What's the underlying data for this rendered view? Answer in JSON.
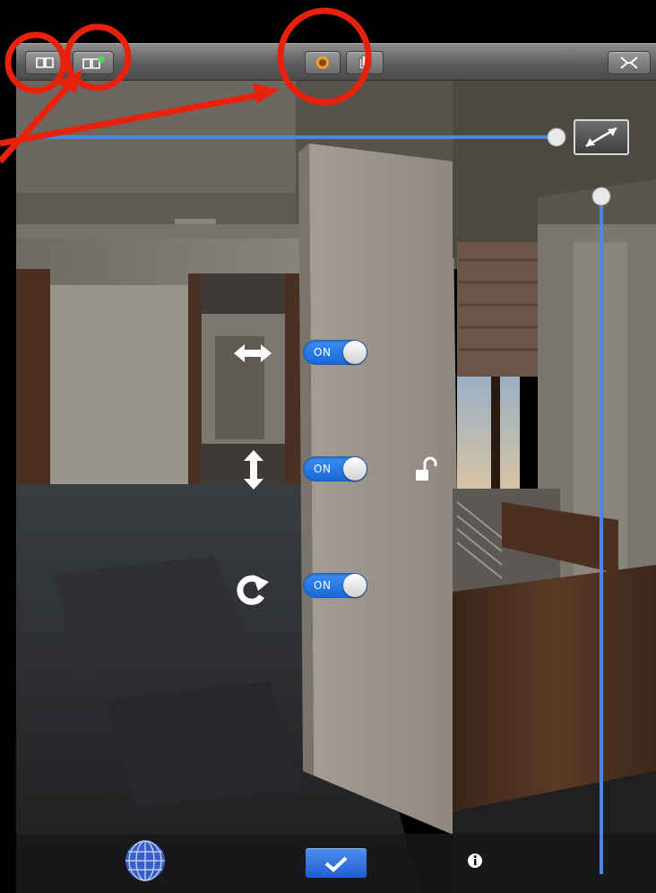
{
  "toolbar": {
    "left_buttons": [
      {
        "icon": "book-icon"
      },
      {
        "icon": "book-add-icon"
      }
    ],
    "center_buttons": [
      {
        "icon": "sun-icon"
      },
      {
        "icon": "pages-icon"
      }
    ],
    "right_button": {
      "icon": "arrows-collapse-icon"
    }
  },
  "controls": [
    {
      "icon": "horizontal-arrows-icon",
      "toggle_label": "ON",
      "state": "on"
    },
    {
      "icon": "vertical-arrows-icon",
      "toggle_label": "ON",
      "state": "on"
    },
    {
      "icon": "rotate-icon",
      "toggle_label": "ON",
      "state": "on"
    }
  ],
  "lock": {
    "icon": "unlock-icon",
    "state": "unlocked"
  },
  "expand_button": {
    "icon": "expand-diagonal-icon"
  },
  "bottom_bar": {
    "globe": {
      "icon": "globe-icon"
    },
    "done": {
      "icon": "checkmark-icon"
    },
    "info": {
      "icon": "info-icon"
    }
  },
  "colors": {
    "annotation": "#e8210d",
    "slider_line": "#4a87e8",
    "toggle_on": "#2b7ff0"
  }
}
